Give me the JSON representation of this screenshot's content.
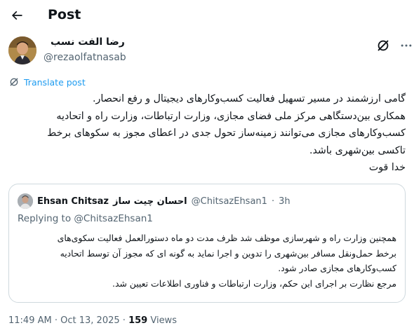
{
  "header": {
    "title": "Post",
    "back_icon": "arrow-left-icon"
  },
  "author": {
    "name": "رضا الفت نسب",
    "handle": "@rezaolfatnasab"
  },
  "actions": {
    "grok_icon": "grok-icon",
    "more_icon": "more-horizontal-icon"
  },
  "translate": {
    "label": "Translate post",
    "icon": "grok-icon"
  },
  "tweet": {
    "lines": [
      "گامی ارزشمند در مسیر تسهیل فعالیت کسب‌وکارهای دیجیتال و رفع انحصار.",
      "همکاری بین‌دستگاهی مرکز ملی فضای مجازی، وزارت ارتباطات، وزارت راه و اتحادیه",
      "کسب‌وکارهای مجازی می‌توانند زمینه‌ساز تحول جدی در اعطای مجوز به سکوهای برخط",
      "تاکسی بین‌شهری باشد.",
      "خدا قوت"
    ]
  },
  "quote": {
    "name_en": "Ehsan Chitsaz",
    "name_fa": "احسان چیت ساز",
    "handle": "@ChitsazEhsan1",
    "separator": "·",
    "time": "3h",
    "replying_prefix": "Replying to",
    "replying_handle": "@ChitsazEhsan1",
    "lines": [
      "همچنین وزارت راه و شهرسازی موظف شد ظرف مدت دو ماه دستورالعمل فعالیت سکوی‌های",
      "برخط حمل‌ونقل مسافر بین‌شهری را تدوین و اجرا نماید به گونه ای که مجوز آن  توسط اتحادیه",
      "کسب‌وکارهای مجازی صادر شود.",
      "مرجع نظارت بر اجرای این حکم، وزارت ارتباطات و فناوری اطلاعات تعیین شد."
    ]
  },
  "meta": {
    "time": "11:49 AM",
    "date": "Oct 13, 2025",
    "separator": "·",
    "views_count": "159",
    "views_label": "Views"
  }
}
